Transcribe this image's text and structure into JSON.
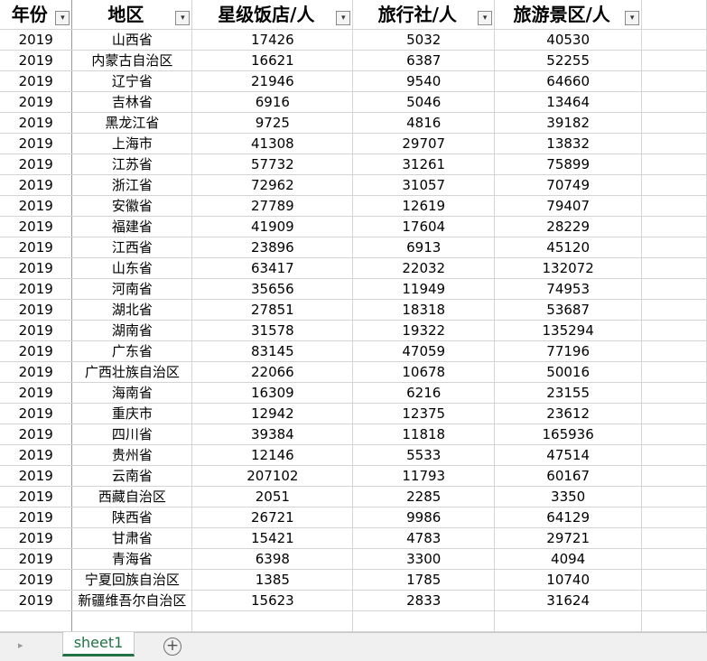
{
  "headers": [
    "年份",
    "地区",
    "星级饭店/人",
    "旅行社/人",
    "旅游景区/人"
  ],
  "filter_icon": "dropdown-arrow-icon",
  "rows": [
    [
      "2019",
      "山西省",
      "17426",
      "5032",
      "40530"
    ],
    [
      "2019",
      "内蒙古自治区",
      "16621",
      "6387",
      "52255"
    ],
    [
      "2019",
      "辽宁省",
      "21946",
      "9540",
      "64660"
    ],
    [
      "2019",
      "吉林省",
      "6916",
      "5046",
      "13464"
    ],
    [
      "2019",
      "黑龙江省",
      "9725",
      "4816",
      "39182"
    ],
    [
      "2019",
      "上海市",
      "41308",
      "29707",
      "13832"
    ],
    [
      "2019",
      "江苏省",
      "57732",
      "31261",
      "75899"
    ],
    [
      "2019",
      "浙江省",
      "72962",
      "31057",
      "70749"
    ],
    [
      "2019",
      "安徽省",
      "27789",
      "12619",
      "79407"
    ],
    [
      "2019",
      "福建省",
      "41909",
      "17604",
      "28229"
    ],
    [
      "2019",
      "江西省",
      "23896",
      "6913",
      "45120"
    ],
    [
      "2019",
      "山东省",
      "63417",
      "22032",
      "132072"
    ],
    [
      "2019",
      "河南省",
      "35656",
      "11949",
      "74953"
    ],
    [
      "2019",
      "湖北省",
      "27851",
      "18318",
      "53687"
    ],
    [
      "2019",
      "湖南省",
      "31578",
      "19322",
      "135294"
    ],
    [
      "2019",
      "广东省",
      "83145",
      "47059",
      "77196"
    ],
    [
      "2019",
      "广西壮族自治区",
      "22066",
      "10678",
      "50016"
    ],
    [
      "2019",
      "海南省",
      "16309",
      "6216",
      "23155"
    ],
    [
      "2019",
      "重庆市",
      "12942",
      "12375",
      "23612"
    ],
    [
      "2019",
      "四川省",
      "39384",
      "11818",
      "165936"
    ],
    [
      "2019",
      "贵州省",
      "12146",
      "5533",
      "47514"
    ],
    [
      "2019",
      "云南省",
      "207102",
      "11793",
      "60167"
    ],
    [
      "2019",
      "西藏自治区",
      "2051",
      "2285",
      "3350"
    ],
    [
      "2019",
      "陕西省",
      "26721",
      "9986",
      "64129"
    ],
    [
      "2019",
      "甘肃省",
      "15421",
      "4783",
      "29721"
    ],
    [
      "2019",
      "青海省",
      "6398",
      "3300",
      "4094"
    ],
    [
      "2019",
      "宁夏回族自治区",
      "1385",
      "1785",
      "10740"
    ],
    [
      "2019",
      "新疆维吾尔自治区",
      "15623",
      "2833",
      "31624"
    ]
  ],
  "sheet_tabs": [
    {
      "label": "sheet1",
      "active": true
    }
  ],
  "sheetbar": {
    "add_icon": "plus-circle-icon",
    "nav_icon": "scroll-right-icon"
  }
}
